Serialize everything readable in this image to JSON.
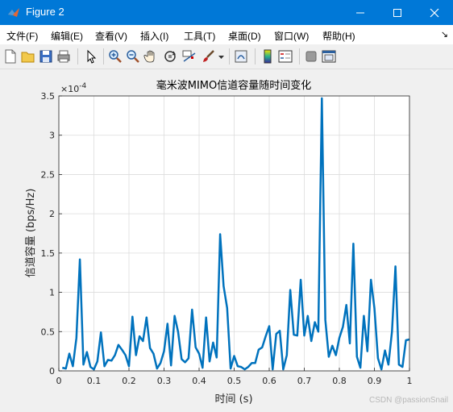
{
  "window": {
    "title": "Figure 2",
    "controls": {
      "minimize": "—",
      "maximize": "☐",
      "close": "✕"
    }
  },
  "menu": {
    "items": [
      "文件(F)",
      "编辑(E)",
      "查看(V)",
      "插入(I)",
      "工具(T)",
      "桌面(D)",
      "窗口(W)",
      "帮助(H)"
    ],
    "overflow": "↘"
  },
  "toolbar": {
    "icons": [
      "new-figure-icon",
      "open-file-icon",
      "save-icon",
      "print-icon",
      "pointer-icon",
      "zoom-in-icon",
      "zoom-out-icon",
      "pan-icon",
      "rotate-3d-icon",
      "data-cursor-icon",
      "brush-icon",
      "brush-dropdown-icon",
      "link-plot-icon",
      "colorbar-icon",
      "legend-icon",
      "hide-plot-tools-icon",
      "show-plot-tools-icon"
    ]
  },
  "watermark": "CSDN @passionSnail",
  "chart_data": {
    "type": "line",
    "title": "毫米波MIMO信道容量随时间变化",
    "xlabel": "时间 (s)",
    "ylabel": "信道容量 (bps/Hz)",
    "exponent_label": "×10",
    "exponent_power": "-4",
    "xlim": [
      0,
      1
    ],
    "ylim": [
      0,
      3.5
    ],
    "xticks": [
      0,
      0.1,
      0.2,
      0.3,
      0.4,
      0.5,
      0.6,
      0.7,
      0.8,
      0.9,
      1
    ],
    "xtick_labels": [
      "0",
      "0.1",
      "0.2",
      "0.3",
      "0.4",
      "0.5",
      "0.6",
      "0.7",
      "0.8",
      "0.9",
      "1"
    ],
    "yticks": [
      0,
      0.5,
      1,
      1.5,
      2,
      2.5,
      3,
      3.5
    ],
    "ytick_labels": [
      "0",
      "0.5",
      "1",
      "1.5",
      "2",
      "2.5",
      "3",
      "3.5"
    ],
    "grid": true,
    "line_color": "#0072bd",
    "series": [
      {
        "x": [
          0.01,
          0.02,
          0.03,
          0.04,
          0.05,
          0.06,
          0.07,
          0.08,
          0.09,
          0.1,
          0.11,
          0.12,
          0.13,
          0.14,
          0.15,
          0.16,
          0.17,
          0.18,
          0.19,
          0.2,
          0.21,
          0.22,
          0.23,
          0.24,
          0.25,
          0.26,
          0.27,
          0.28,
          0.29,
          0.3,
          0.31,
          0.32,
          0.33,
          0.34,
          0.35,
          0.36,
          0.37,
          0.38,
          0.39,
          0.4,
          0.41,
          0.42,
          0.43,
          0.44,
          0.45,
          0.46,
          0.47,
          0.48,
          0.49,
          0.5,
          0.51,
          0.52,
          0.53,
          0.54,
          0.55,
          0.56,
          0.57,
          0.58,
          0.59,
          0.6,
          0.61,
          0.62,
          0.63,
          0.64,
          0.65,
          0.66,
          0.67,
          0.68,
          0.69,
          0.7,
          0.71,
          0.72,
          0.73,
          0.74,
          0.75,
          0.76,
          0.77,
          0.78,
          0.79,
          0.8,
          0.81,
          0.82,
          0.83,
          0.84,
          0.85,
          0.86,
          0.87,
          0.88,
          0.89,
          0.9,
          0.91,
          0.92,
          0.93,
          0.94,
          0.95,
          0.96,
          0.97,
          0.98,
          0.99,
          1.0
        ],
        "y": [
          0.04,
          0.03,
          0.22,
          0.06,
          0.42,
          1.42,
          0.08,
          0.24,
          0.05,
          0.02,
          0.12,
          0.49,
          0.06,
          0.14,
          0.13,
          0.2,
          0.33,
          0.27,
          0.2,
          0.06,
          0.69,
          0.2,
          0.44,
          0.38,
          0.68,
          0.29,
          0.22,
          0.03,
          0.1,
          0.25,
          0.6,
          0.07,
          0.7,
          0.5,
          0.15,
          0.11,
          0.16,
          0.78,
          0.3,
          0.22,
          0.04,
          0.68,
          0.12,
          0.36,
          0.17,
          1.74,
          1.08,
          0.8,
          0.03,
          0.19,
          0.06,
          0.05,
          0.02,
          0.05,
          0.1,
          0.1,
          0.27,
          0.3,
          0.44,
          0.57,
          0.02,
          0.47,
          0.51,
          0.02,
          0.2,
          1.03,
          0.46,
          0.45,
          1.16,
          0.45,
          0.7,
          0.38,
          0.62,
          0.5,
          3.47,
          0.65,
          0.18,
          0.32,
          0.2,
          0.42,
          0.56,
          0.84,
          0.35,
          1.62,
          0.18,
          0.04,
          0.7,
          0.25,
          1.16,
          0.8,
          0.16,
          0.02,
          0.26,
          0.08,
          0.5,
          1.33,
          0.08,
          0.05,
          0.39,
          0.4
        ]
      }
    ]
  }
}
